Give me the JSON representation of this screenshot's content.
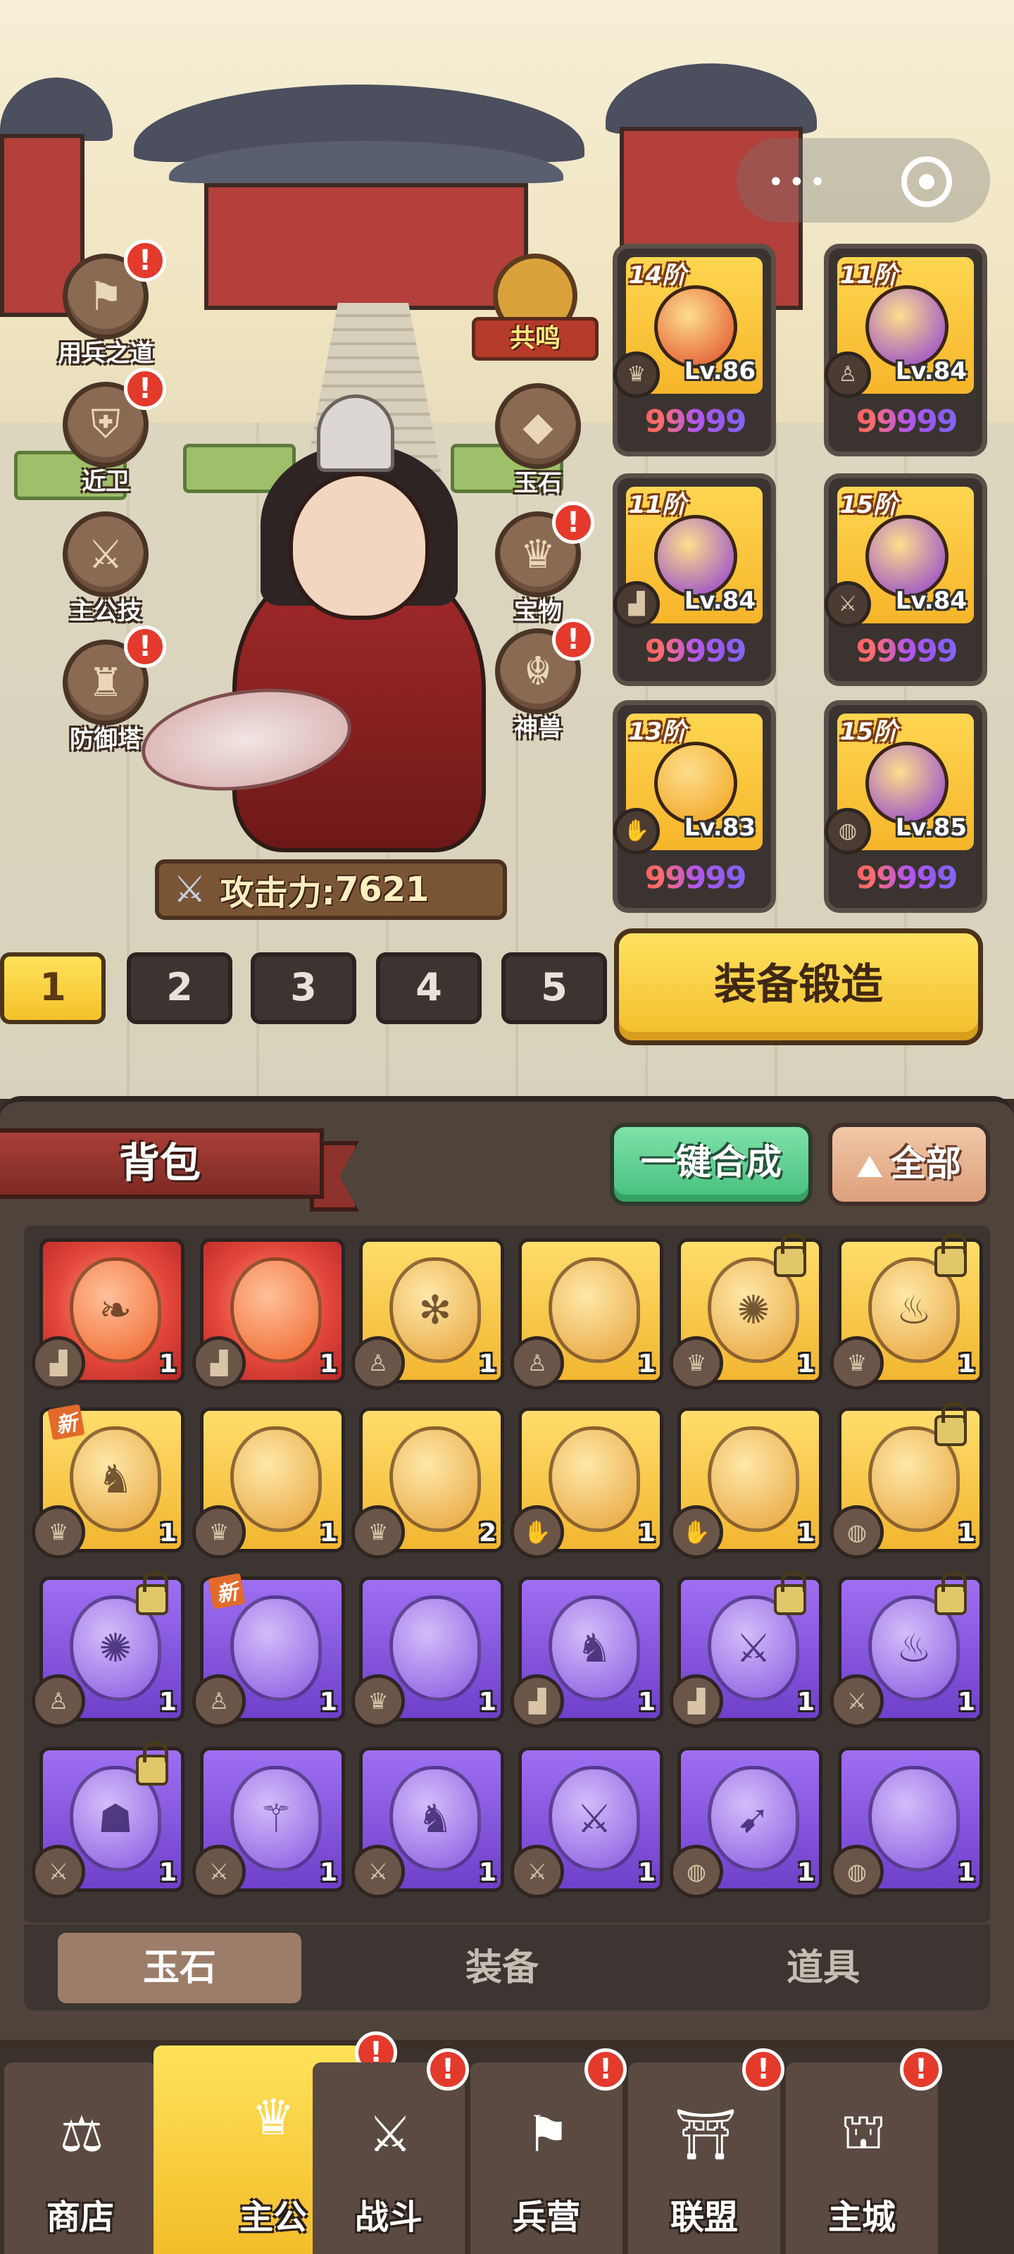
{
  "left_menu": [
    {
      "label": "用兵之道",
      "icon": "strategy-icon",
      "alert": true
    },
    {
      "label": "近卫",
      "icon": "guard-icon",
      "alert": true
    },
    {
      "label": "主公技",
      "icon": "lord-skill-icon",
      "alert": false
    },
    {
      "label": "防御塔",
      "icon": "defense-tower-icon",
      "alert": true
    }
  ],
  "right_menu": [
    {
      "label": "玉石",
      "icon": "jade-icon",
      "alert": false
    },
    {
      "label": "宝物",
      "icon": "treasure-icon",
      "alert": true
    },
    {
      "label": "神兽",
      "icon": "divine-beast-icon",
      "alert": true
    }
  ],
  "resonance": {
    "label": "共鸣"
  },
  "attack": {
    "label": "攻击力:",
    "value": "7621"
  },
  "equipment": [
    {
      "tier": "14阶",
      "level": "Lv.86",
      "quality": "99999",
      "item": "helmet",
      "color": "#e04b2a"
    },
    {
      "tier": "11阶",
      "level": "Lv.84",
      "quality": "99999",
      "item": "armor",
      "color": "#8b3bd6"
    },
    {
      "tier": "11阶",
      "level": "Lv.84",
      "quality": "99999",
      "item": "boots",
      "color": "#8b3bd6"
    },
    {
      "tier": "15阶",
      "level": "Lv.84",
      "quality": "99999",
      "item": "sword",
      "color": "#8b3bd6"
    },
    {
      "tier": "13阶",
      "level": "Lv.83",
      "quality": "99999",
      "item": "bracer",
      "color": "#f2a21a"
    },
    {
      "tier": "15阶",
      "level": "Lv.85",
      "quality": "99999",
      "item": "ring",
      "color": "#8b3bd6"
    }
  ],
  "loadouts": [
    "1",
    "2",
    "3",
    "4",
    "5"
  ],
  "active_loadout": 0,
  "forge_button": "装备锻造",
  "bag": {
    "title": "背包",
    "merge_button": "一键合成",
    "filter_button": "全部",
    "tabs": [
      "玉石",
      "装备",
      "道具"
    ],
    "active_tab": 0,
    "items": [
      {
        "rarity": "red",
        "symbol": "❧",
        "count": "1",
        "slot": "boots",
        "lock": false,
        "new": false
      },
      {
        "rarity": "red",
        "symbol": "",
        "count": "1",
        "slot": "boots",
        "lock": false,
        "new": false
      },
      {
        "rarity": "gold",
        "symbol": "✻",
        "count": "1",
        "slot": "armor",
        "lock": false,
        "new": false
      },
      {
        "rarity": "gold",
        "symbol": "",
        "count": "1",
        "slot": "armor",
        "lock": false,
        "new": false
      },
      {
        "rarity": "gold",
        "symbol": "✺",
        "count": "1",
        "slot": "helmet",
        "lock": true,
        "new": false
      },
      {
        "rarity": "gold",
        "symbol": "♨",
        "count": "1",
        "slot": "helmet",
        "lock": true,
        "new": false
      },
      {
        "rarity": "gold",
        "symbol": "♞",
        "count": "1",
        "slot": "helmet",
        "lock": false,
        "new": true
      },
      {
        "rarity": "gold",
        "symbol": "",
        "count": "1",
        "slot": "helmet",
        "lock": false,
        "new": false
      },
      {
        "rarity": "gold",
        "symbol": "",
        "count": "2",
        "slot": "helmet",
        "lock": false,
        "new": false
      },
      {
        "rarity": "gold",
        "symbol": "",
        "count": "1",
        "slot": "bracer",
        "lock": false,
        "new": false
      },
      {
        "rarity": "gold",
        "symbol": "",
        "count": "1",
        "slot": "bracer",
        "lock": false,
        "new": false
      },
      {
        "rarity": "gold",
        "symbol": "",
        "count": "1",
        "slot": "ring",
        "lock": true,
        "new": false
      },
      {
        "rarity": "purple",
        "symbol": "✺",
        "count": "1",
        "slot": "armor",
        "lock": true,
        "new": false
      },
      {
        "rarity": "purple",
        "symbol": "",
        "count": "1",
        "slot": "armor",
        "lock": false,
        "new": true
      },
      {
        "rarity": "purple",
        "symbol": "",
        "count": "1",
        "slot": "helmet",
        "lock": false,
        "new": false
      },
      {
        "rarity": "purple",
        "symbol": "♞",
        "count": "1",
        "slot": "boots",
        "lock": false,
        "new": false
      },
      {
        "rarity": "purple",
        "symbol": "⚔",
        "count": "1",
        "slot": "boots",
        "lock": true,
        "new": false
      },
      {
        "rarity": "purple",
        "symbol": "♨",
        "count": "1",
        "slot": "sword",
        "lock": true,
        "new": false
      },
      {
        "rarity": "purple",
        "symbol": "☗",
        "count": "1",
        "slot": "sword",
        "lock": true,
        "new": false
      },
      {
        "rarity": "purple",
        "symbol": "⚚",
        "count": "1",
        "slot": "sword",
        "lock": false,
        "new": false
      },
      {
        "rarity": "purple",
        "symbol": "♞",
        "count": "1",
        "slot": "sword",
        "lock": false,
        "new": false
      },
      {
        "rarity": "purple",
        "symbol": "⚔",
        "count": "1",
        "slot": "sword",
        "lock": false,
        "new": false
      },
      {
        "rarity": "purple",
        "symbol": "➹",
        "count": "1",
        "slot": "ring",
        "lock": false,
        "new": false
      },
      {
        "rarity": "purple",
        "symbol": "",
        "count": "1",
        "slot": "ring",
        "lock": false,
        "new": false
      }
    ]
  },
  "bottom_nav": [
    {
      "label": "商店",
      "icon": "shop-icon",
      "alert": false
    },
    {
      "label": "主公",
      "icon": "lord-icon",
      "alert": true
    },
    {
      "label": "战斗",
      "icon": "battle-icon",
      "alert": true
    },
    {
      "label": "兵营",
      "icon": "barracks-icon",
      "alert": true
    },
    {
      "label": "联盟",
      "icon": "alliance-icon",
      "alert": true
    },
    {
      "label": "主城",
      "icon": "main-city-icon",
      "alert": true
    }
  ],
  "active_nav": 1,
  "new_badge": "新",
  "alert_mark": "!"
}
